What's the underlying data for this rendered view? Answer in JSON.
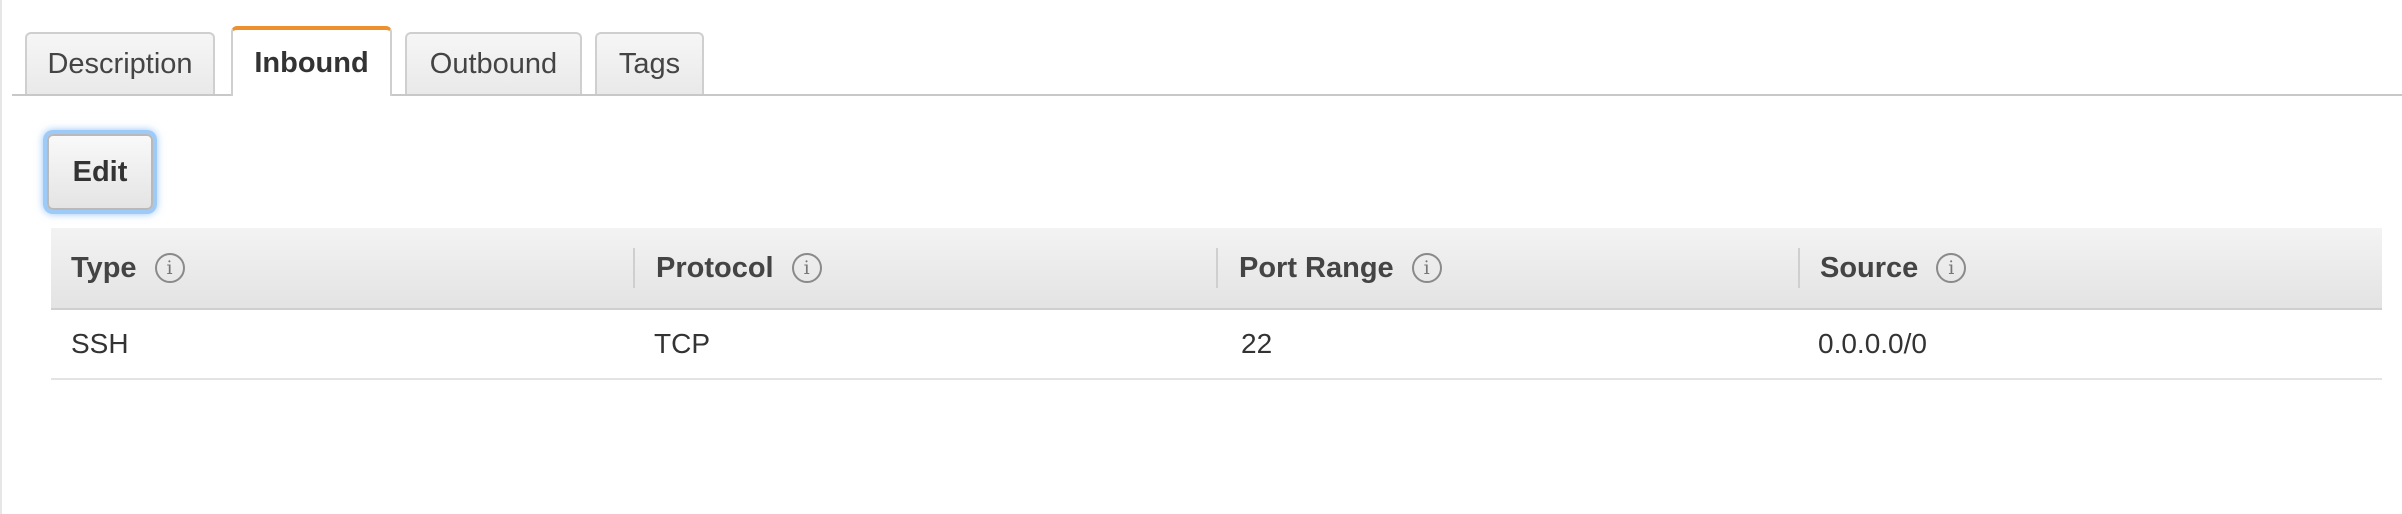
{
  "tabs": {
    "description": "Description",
    "inbound": "Inbound",
    "outbound": "Outbound",
    "tags": "Tags",
    "active": "Inbound"
  },
  "toolbar": {
    "edit_label": "Edit"
  },
  "table": {
    "columns": [
      "Type",
      "Protocol",
      "Port Range",
      "Source"
    ],
    "info_icon": "i",
    "rows": [
      [
        "SSH",
        "TCP",
        "22",
        "0.0.0.0/0"
      ]
    ]
  },
  "colors": {
    "active_tab_accent": "#ec912d",
    "focus_ring": "#9ecaf7"
  }
}
